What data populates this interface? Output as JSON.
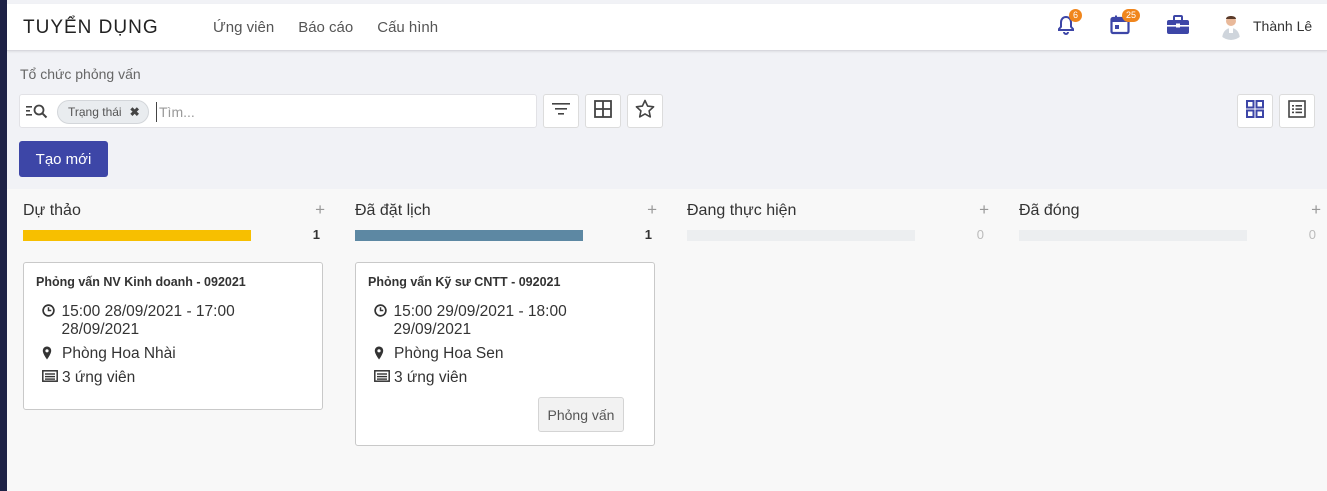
{
  "app": {
    "title": "TUYỂN DỤNG"
  },
  "menu": [
    "Ứng viên",
    "Báo cáo",
    "Cấu hình"
  ],
  "systray": {
    "notifications_count": "6",
    "activities_count": "25",
    "user_name": "Thành Lê"
  },
  "breadcrumb": "Tổ chức phỏng vấn",
  "search": {
    "facet_label": "Trạng thái",
    "placeholder": "Tìm..."
  },
  "actions": {
    "create_label": "Tạo mới"
  },
  "colors": {
    "accent": "#3d46a7",
    "draft": "#f7bf00",
    "scheduled": "#5d88a3",
    "badge": "#f0861d"
  },
  "columns": [
    {
      "title": "Dự thảo",
      "count": "1",
      "progress": 1.0,
      "cards": [
        {
          "title": "Phỏng vấn NV Kinh doanh - 092021",
          "time": "15:00 28/09/2021 - 17:00 28/09/2021",
          "location": "Phòng Hoa Nhài",
          "candidates": "3 ứng viên"
        }
      ]
    },
    {
      "title": "Đã đặt lịch",
      "count": "1",
      "progress": 1.0,
      "cards": [
        {
          "title": "Phỏng vấn Kỹ sư CNTT - 092021",
          "time": "15:00 29/09/2021 - 18:00 29/09/2021",
          "location": "Phòng Hoa Sen",
          "candidates": "3 ứng viên",
          "button": "Phỏng vấn"
        }
      ]
    },
    {
      "title": "Đang thực hiện",
      "count": "0",
      "progress": 0,
      "cards": []
    },
    {
      "title": "Đã đóng",
      "count": "0",
      "progress": 0,
      "cards": []
    }
  ]
}
